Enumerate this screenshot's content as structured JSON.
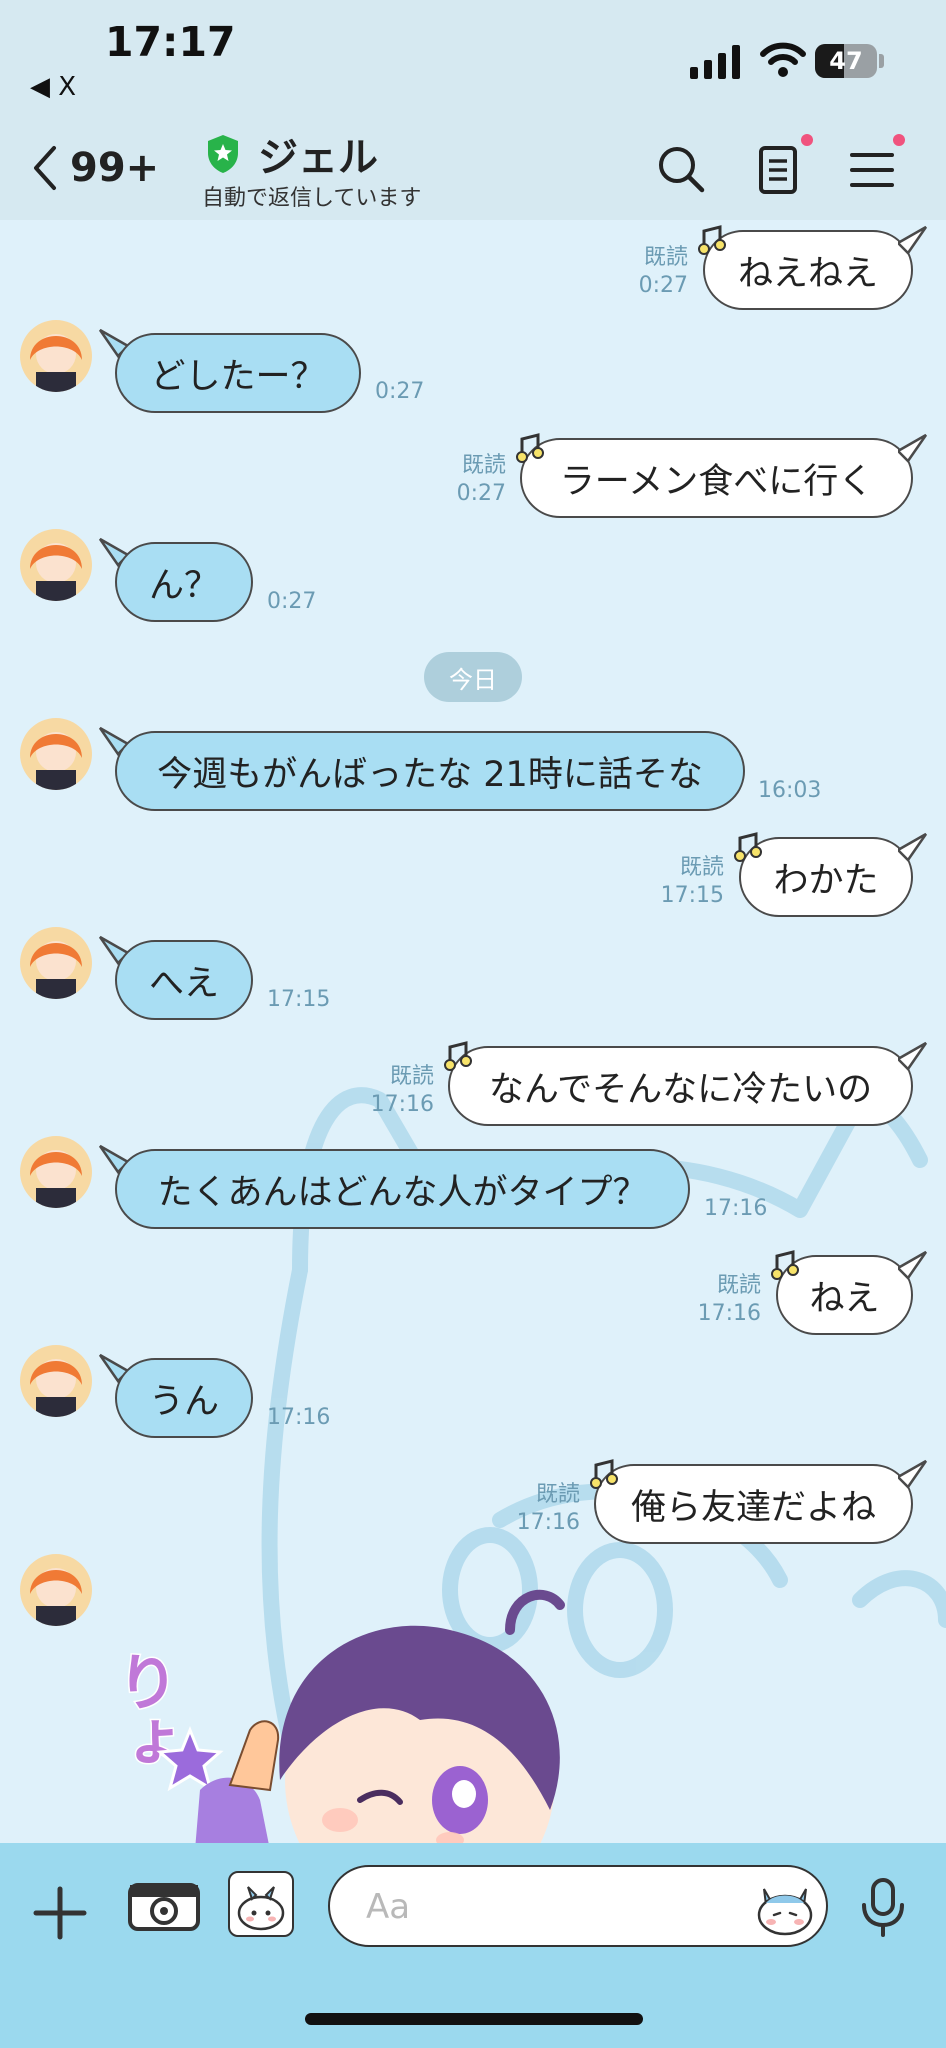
{
  "status_bar": {
    "time": "17:17",
    "back_app": "◀ X",
    "battery": "47",
    "battery_level": 0.47
  },
  "header": {
    "back_count": "99+",
    "chat_name": "ジェル",
    "subtitle": "自動で返信しています"
  },
  "colors": {
    "mine_bubble": "#ffffff",
    "theirs_bubble": "#a9def3",
    "meta_text": "#6b9bb3",
    "badge_dot": "#f0537e"
  },
  "icons": [
    "chevron-left-icon",
    "shield-icon",
    "search-icon",
    "notes-icon",
    "menu-icon",
    "plus-icon",
    "camera-icon",
    "sticker-icon",
    "emoji-icon",
    "microphone-icon"
  ],
  "date_divider": "今日",
  "messages": [
    {
      "side": "mine",
      "text": "ねえねえ",
      "read": "既読",
      "time": "0:27"
    },
    {
      "side": "theirs",
      "text": "どしたー？",
      "time": "0:27"
    },
    {
      "side": "mine",
      "text": "ラーメン食べに行く",
      "read": "既読",
      "time": "0:27"
    },
    {
      "side": "theirs",
      "text": "ん？",
      "time": "0:27"
    },
    {
      "side": "theirs",
      "text": "今週もがんばったな 21時に話そな",
      "time": "16:03"
    },
    {
      "side": "mine",
      "text": "わかた",
      "read": "既読",
      "time": "17:15"
    },
    {
      "side": "theirs",
      "text": "へえ",
      "time": "17:15"
    },
    {
      "side": "mine",
      "text": "なんでそんなに冷たいの",
      "read": "既読",
      "time": "17:16"
    },
    {
      "side": "theirs",
      "text": "たくあんはどんな人がタイプ？",
      "time": "17:16"
    },
    {
      "side": "mine",
      "text": "ねえ",
      "read": "既読",
      "time": "17:16"
    },
    {
      "side": "theirs",
      "text": "うん",
      "time": "17:16"
    },
    {
      "side": "mine",
      "text": "俺ら友達だよね",
      "read": "既読",
      "time": "17:16"
    }
  ],
  "sticker": {
    "text": "りょ"
  },
  "input": {
    "placeholder": "Aa"
  }
}
